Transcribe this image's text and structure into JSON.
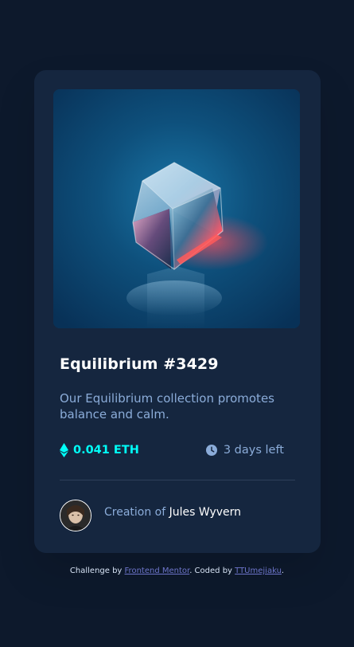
{
  "card": {
    "image_alt": "Equilibrium cube",
    "title": "Equilibrium #3429",
    "description": "Our Equilibrium collection promotes balance and calm.",
    "price": "0.041 ETH",
    "time_left": "3 days left",
    "creation_prefix": "Creation of",
    "creator_name": "Jules Wyvern"
  },
  "footer": {
    "prefix": "Challenge by ",
    "link1": "Frontend Mentor",
    "middle": ". Coded by ",
    "link2": "TTUmejiaku",
    "suffix": "."
  },
  "icons": {
    "eth": "ethereum-icon",
    "clock": "clock-icon"
  },
  "colors": {
    "background": "#0d192c",
    "card": "#15263f",
    "accent": "#00fff8",
    "muted": "#8bacd9",
    "white": "#ffffff",
    "link": "#6c74c9"
  }
}
